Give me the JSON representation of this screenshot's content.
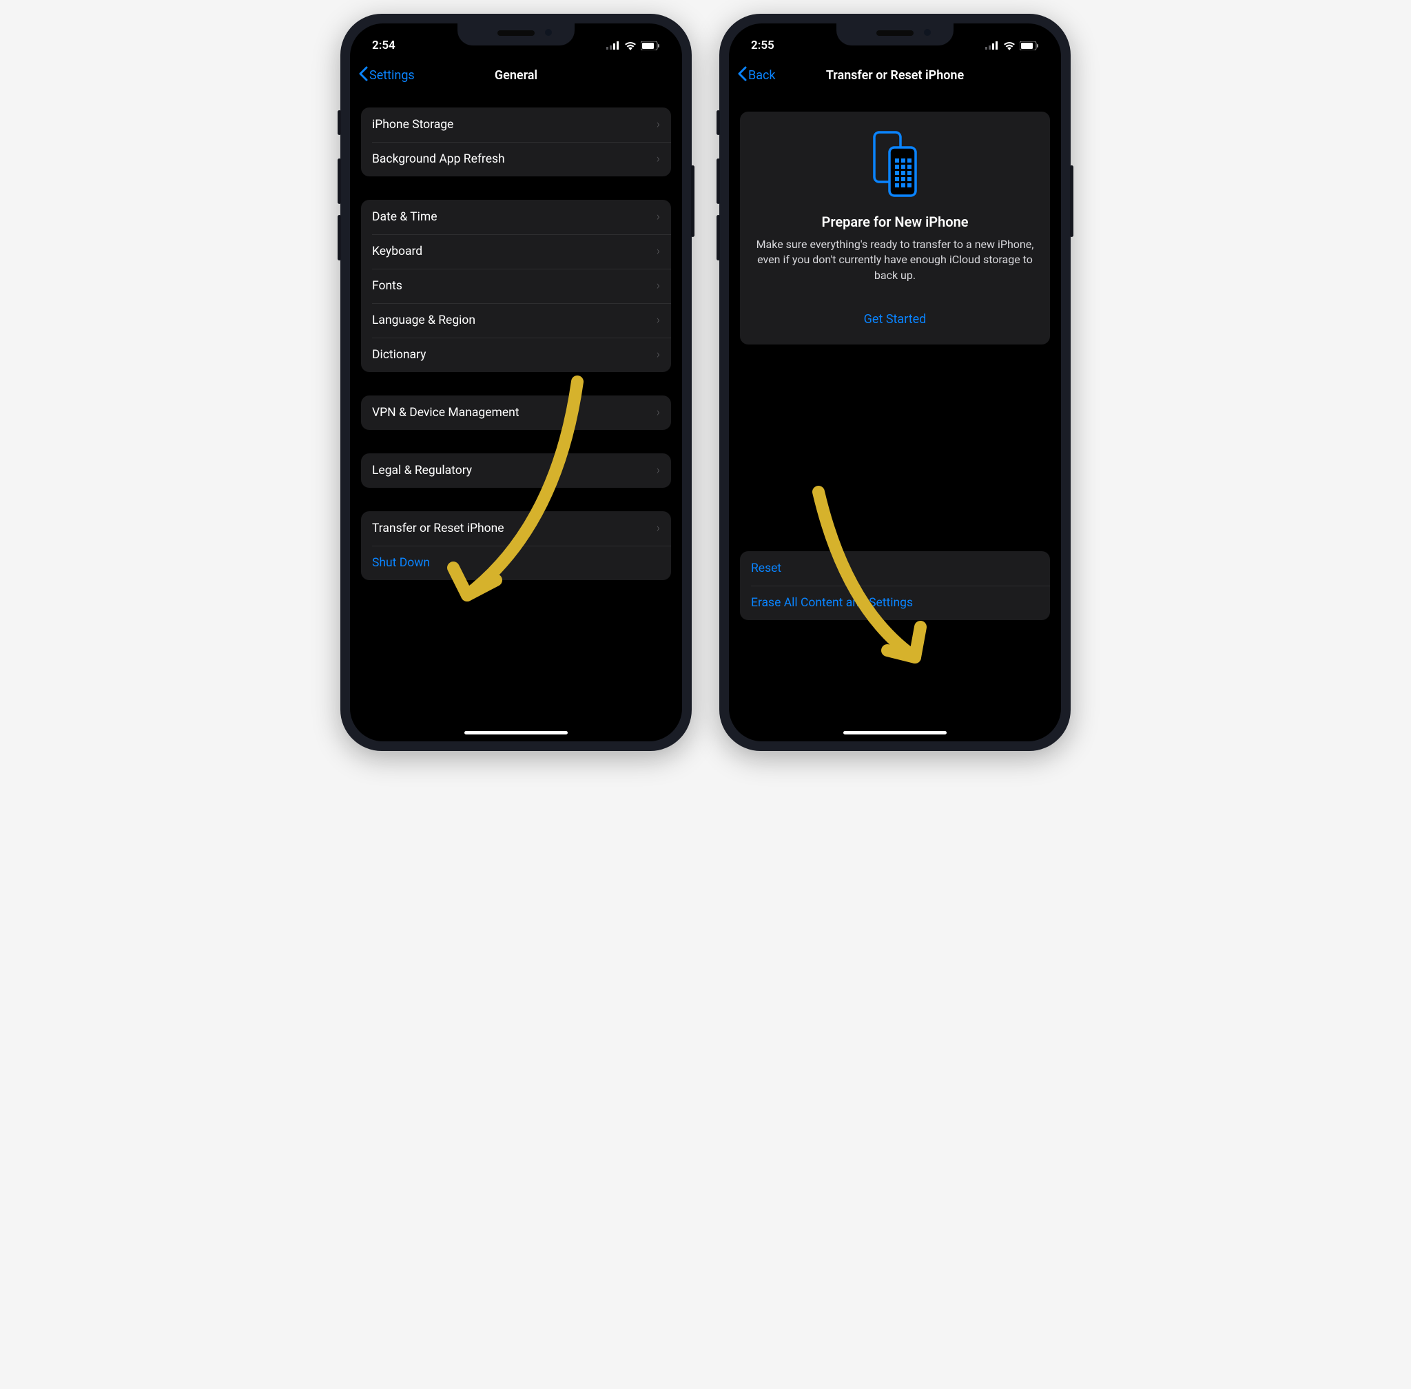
{
  "screen1": {
    "status": {
      "time": "2:54"
    },
    "nav": {
      "back_label": "Settings",
      "title": "General"
    },
    "group1": [
      {
        "label": "iPhone Storage"
      },
      {
        "label": "Background App Refresh"
      }
    ],
    "group2": [
      {
        "label": "Date & Time"
      },
      {
        "label": "Keyboard"
      },
      {
        "label": "Fonts"
      },
      {
        "label": "Language & Region"
      },
      {
        "label": "Dictionary"
      }
    ],
    "group3": [
      {
        "label": "VPN & Device Management"
      }
    ],
    "group4": [
      {
        "label": "Legal & Regulatory"
      }
    ],
    "group5": {
      "transfer_label": "Transfer or Reset iPhone",
      "shutdown_label": "Shut Down"
    }
  },
  "screen2": {
    "status": {
      "time": "2:55"
    },
    "nav": {
      "back_label": "Back",
      "title": "Transfer or Reset iPhone"
    },
    "card": {
      "title": "Prepare for New iPhone",
      "body": "Make sure everything's ready to transfer to a new iPhone, even if you don't currently have enough iCloud storage to back up.",
      "button": "Get Started"
    },
    "bottom_group": {
      "reset_label": "Reset",
      "erase_label": "Erase All Content and Settings"
    }
  },
  "colors": {
    "accent": "#0a84ff"
  }
}
